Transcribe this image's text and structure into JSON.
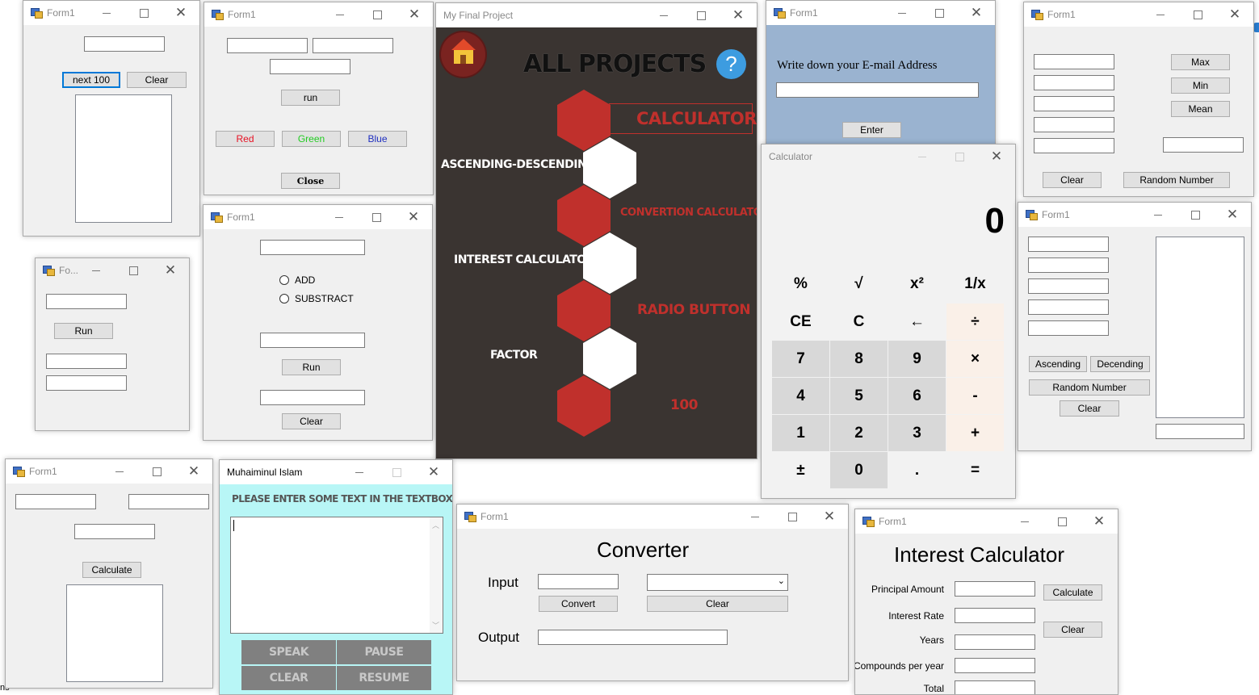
{
  "w1": {
    "title": "Form1",
    "next_label": "next 100",
    "clear_label": "Clear"
  },
  "w2": {
    "title": "Form1",
    "run_label": "run",
    "red_label": "Red",
    "green_label": "Green",
    "blue_label": "Blue",
    "close_label": "Close",
    "colors": {
      "red": "#e81123",
      "green": "#22cc22",
      "blue": "#1f2fc0"
    }
  },
  "w3": {
    "title": "Fo...",
    "run_label": "Run"
  },
  "w4": {
    "title": "Form1",
    "radio_add": "ADD",
    "radio_subtract": "SUBSTRACT",
    "run_label": "Run",
    "clear_label": "Clear"
  },
  "w5": {
    "title": "My Final Project",
    "heading": "ALL PROJECTS",
    "help_icon": "?",
    "items": {
      "calculator": "CALCULATOR",
      "ascending": "ASCENDING-DESCENDING",
      "conversion": "CONVERTION CALCULATOR",
      "interest": "INTEREST CALCULATOR",
      "radio": "RADIO BUTTON",
      "factor": "FACTOR",
      "hundred": "100"
    },
    "colors": {
      "background": "#3a3431",
      "accent": "#c0302c"
    }
  },
  "w6": {
    "title": "Form1",
    "prompt": "Write down your E-mail Address",
    "enter_label": "Enter",
    "colors": {
      "background": "#9ab3d0"
    }
  },
  "w7": {
    "title": "Calculator",
    "display": "0",
    "keys": {
      "percent": "%",
      "sqrt": "√",
      "square": "x²",
      "reciprocal": "1/x",
      "ce": "CE",
      "c": "C",
      "back": "←",
      "divide": "÷",
      "k7": "7",
      "k8": "8",
      "k9": "9",
      "multiply": "×",
      "k4": "4",
      "k5": "5",
      "k6": "6",
      "minus": "-",
      "k1": "1",
      "k2": "2",
      "k3": "3",
      "plus": "+",
      "negate": "±",
      "k0": "0",
      "dot": ".",
      "equals": "="
    }
  },
  "w8": {
    "title": "Form1",
    "max_label": "Max",
    "min_label": "Min",
    "mean_label": "Mean",
    "clear_label": "Clear",
    "random_label": "Random Number"
  },
  "w9": {
    "title": "Form1",
    "ascending_label": "Ascending",
    "descending_label": "Decending",
    "random_label": "Random Number",
    "clear_label": "Clear"
  },
  "w10": {
    "title": "Form1",
    "calculate_label": "Calculate"
  },
  "w11": {
    "title": "Muhaiminul Islam",
    "prompt": "PLEASE ENTER SOME TEXT IN THE TEXTBOX",
    "speak_label": "SPEAK",
    "pause_label": "PAUSE",
    "clear_label": "CLEAR",
    "resume_label": "RESUME",
    "colors": {
      "background": "#b8f6f6"
    }
  },
  "w12": {
    "title": "Form1",
    "heading": "Converter",
    "input_label": "Input",
    "output_label": "Output",
    "convert_label": "Convert",
    "clear_label": "Clear"
  },
  "w13": {
    "title": "Form1",
    "heading": "Interest Calculator",
    "principal_label": "Principal Amount",
    "rate_label": "Interest Rate",
    "years_label": "Years",
    "compounds_label": "Compounds per year",
    "total_label": "Total",
    "calculate_label": "Calculate",
    "clear_label": "Clear"
  }
}
